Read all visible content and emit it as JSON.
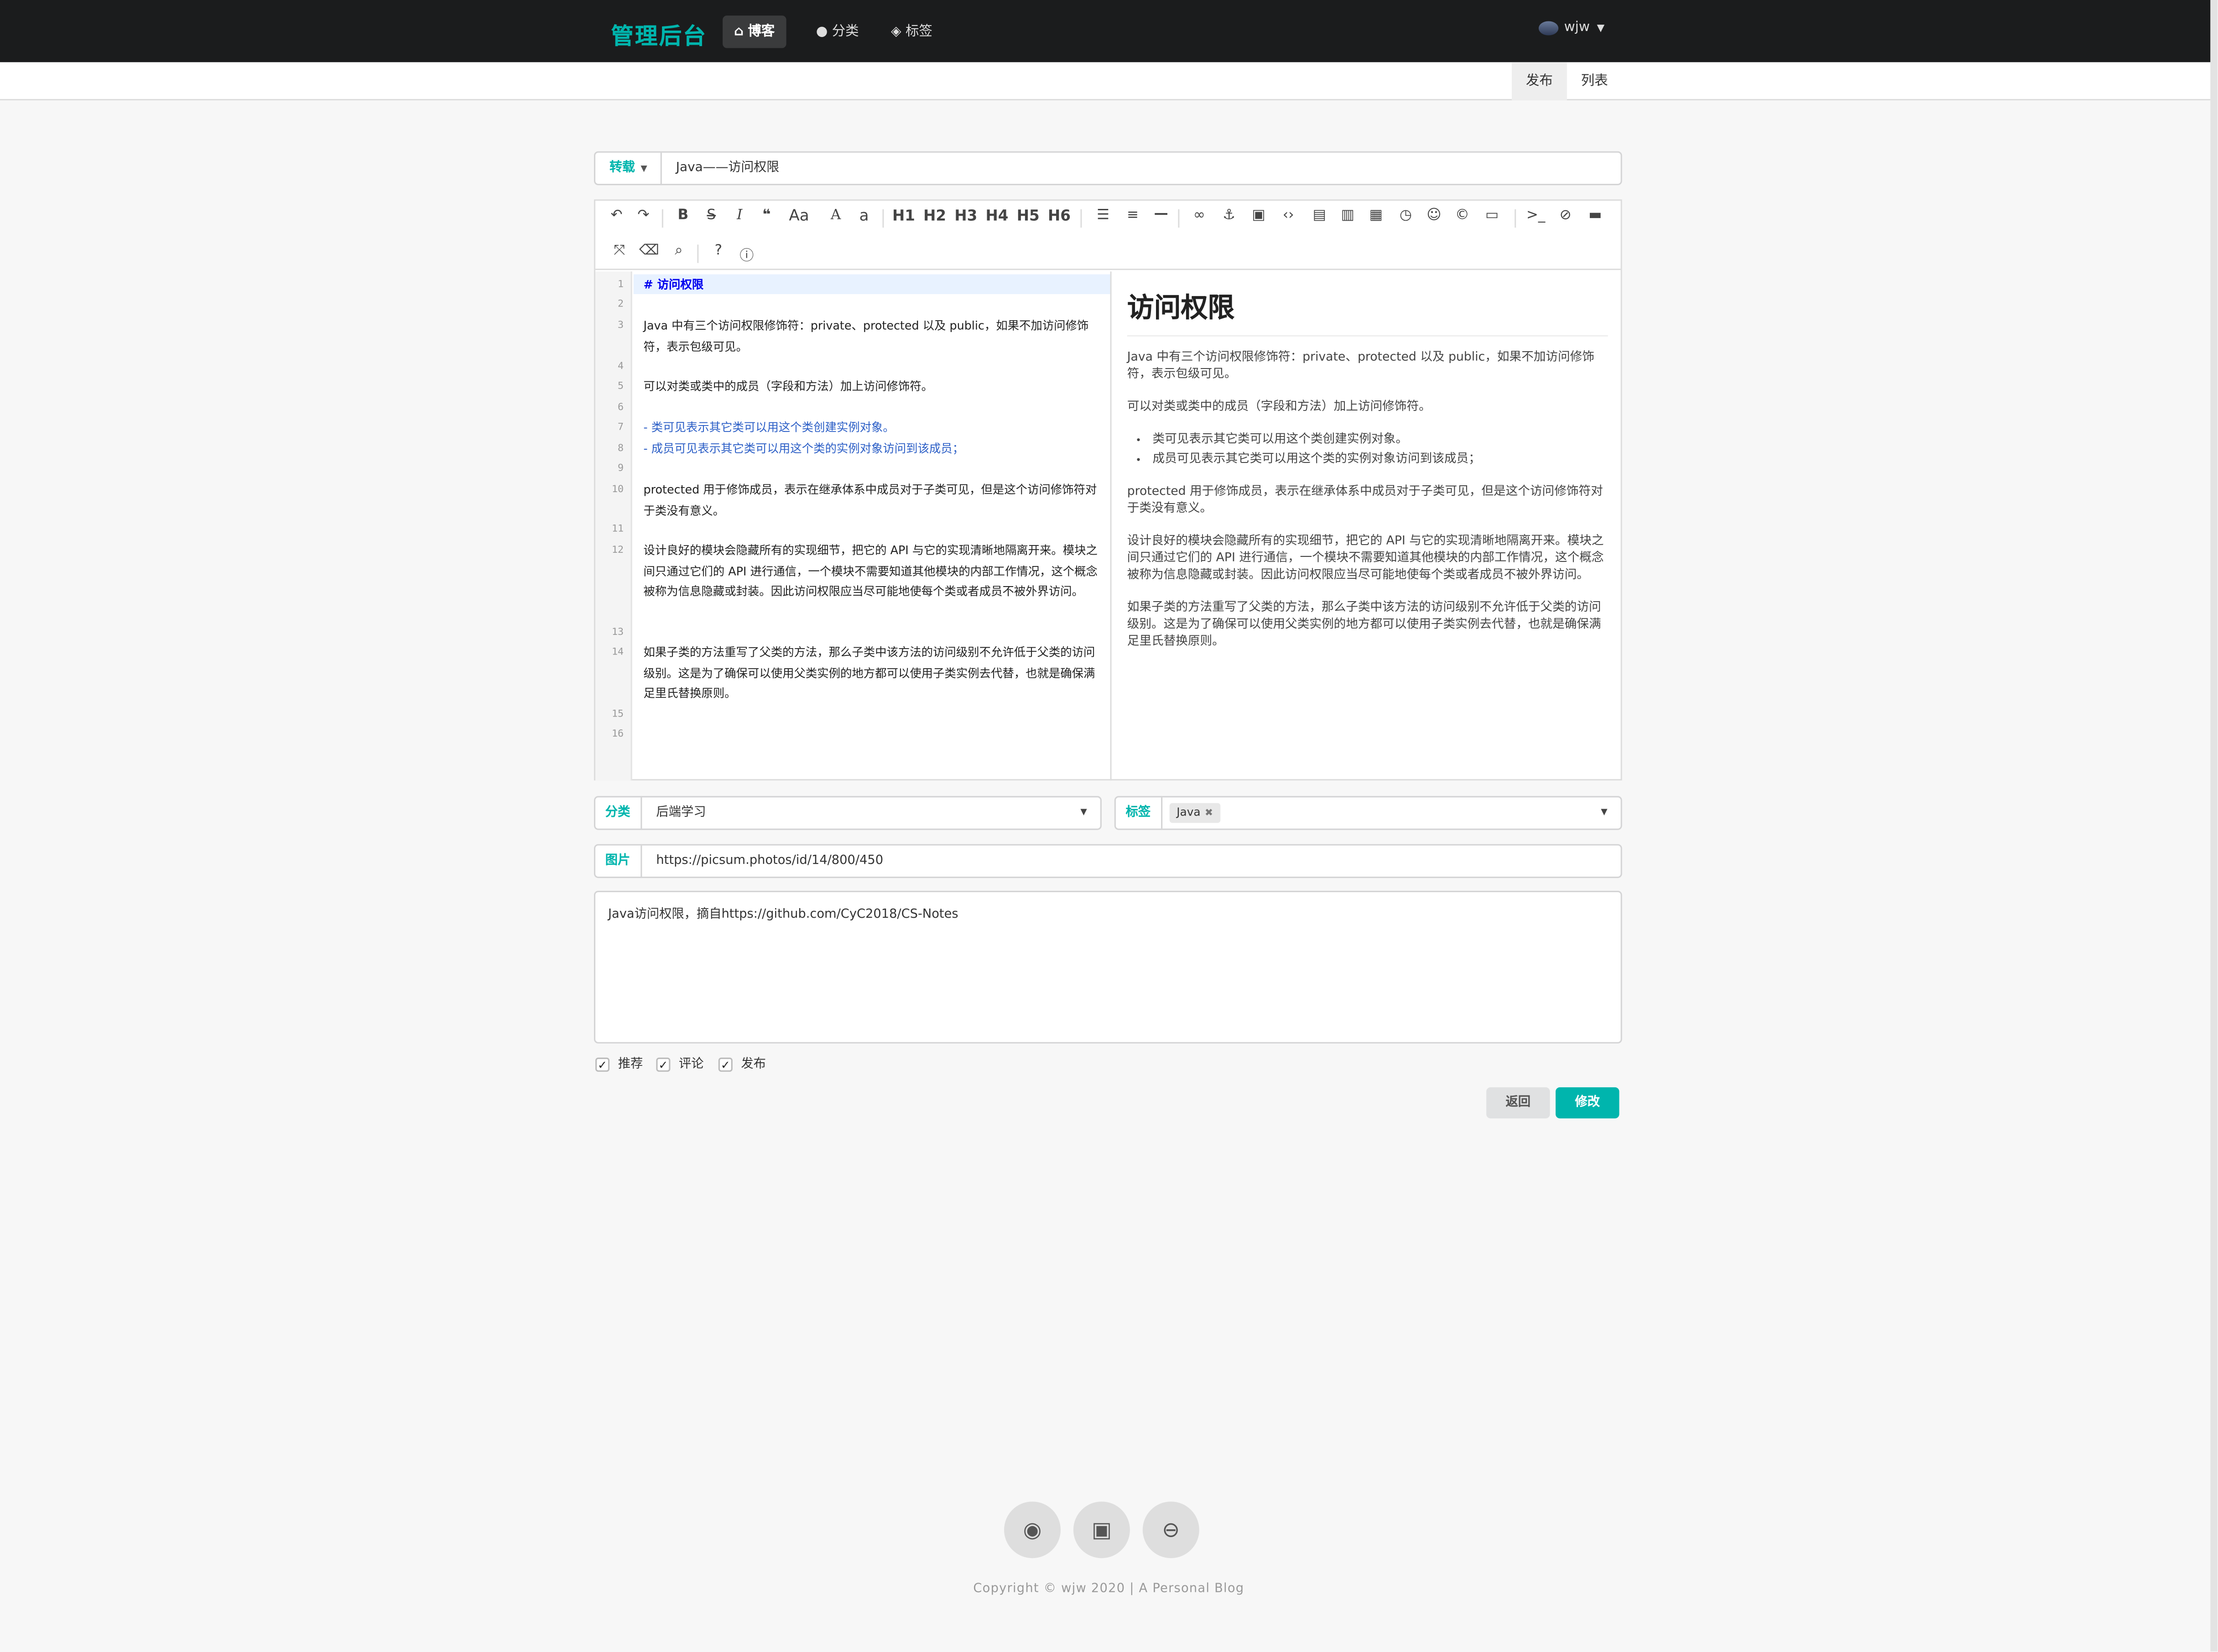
{
  "nav": {
    "brand": "管理后台",
    "items": [
      {
        "label": "博客",
        "icon": "home-icon",
        "active": true
      },
      {
        "label": "分类",
        "icon": "lightbulb-icon",
        "active": false
      },
      {
        "label": "标签",
        "icon": "tags-icon",
        "active": false
      }
    ],
    "user": "wjw"
  },
  "subnav": {
    "publish": "发布",
    "list": "列表"
  },
  "post": {
    "type_label": "转载",
    "title": "Java——访问权限"
  },
  "toolbar": {
    "headings": [
      "H1",
      "H2",
      "H3",
      "H4",
      "H5",
      "H6"
    ]
  },
  "editor": {
    "lines": [
      {
        "n": "1",
        "text": "# 访问权限"
      },
      {
        "n": "2",
        "text": ""
      },
      {
        "n": "3",
        "text": "Java 中有三个访问权限修饰符：private、protected 以及 public，如果不加访问修饰符，表示包级可见。"
      },
      {
        "n": "4",
        "text": ""
      },
      {
        "n": "5",
        "text": "可以对类或类中的成员（字段和方法）加上访问修饰符。"
      },
      {
        "n": "6",
        "text": ""
      },
      {
        "n": "7",
        "text": "- 类可见表示其它类可以用这个类创建实例对象。"
      },
      {
        "n": "8",
        "text": "- 成员可见表示其它类可以用这个类的实例对象访问到该成员；"
      },
      {
        "n": "9",
        "text": ""
      },
      {
        "n": "10",
        "text": "protected 用于修饰成员，表示在继承体系中成员对于子类可见，但是这个访问修饰符对于类没有意义。"
      },
      {
        "n": "11",
        "text": ""
      },
      {
        "n": "12",
        "text": "设计良好的模块会隐藏所有的实现细节，把它的 API 与它的实现清晰地隔离开来。模块之间只通过它们的 API 进行通信，一个模块不需要知道其他模块的内部工作情况，这个概念被称为信息隐藏或封装。因此访问权限应当尽可能地使每个类或者成员不被外界访问。"
      },
      {
        "n": "13",
        "text": ""
      },
      {
        "n": "14",
        "text": "如果子类的方法重写了父类的方法，那么子类中该方法的访问级别不允许低于父类的访问级别。这是为了确保可以使用父类实例的地方都可以使用子类实例去代替，也就是确保满足里氏替换原则。"
      },
      {
        "n": "15",
        "text": ""
      },
      {
        "n": "16",
        "text": ""
      }
    ]
  },
  "preview": {
    "h1": "访问权限",
    "p1": "Java 中有三个访问权限修饰符：private、protected 以及 public，如果不加访问修饰符，表示包级可见。",
    "p2": "可以对类或类中的成员（字段和方法）加上访问修饰符。",
    "li1": "类可见表示其它类可以用这个类创建实例对象。",
    "li2": "成员可见表示其它类可以用这个类的实例对象访问到该成员；",
    "p3": "protected 用于修饰成员，表示在继承体系中成员对于子类可见，但是这个访问修饰符对于类没有意义。",
    "p4": "设计良好的模块会隐藏所有的实现细节，把它的 API 与它的实现清晰地隔离开来。模块之间只通过它们的 API 进行通信，一个模块不需要知道其他模块的内部工作情况，这个概念被称为信息隐藏或封装。因此访问权限应当尽可能地使每个类或者成员不被外界访问。",
    "p5": "如果子类的方法重写了父类的方法，那么子类中该方法的访问级别不允许低于父类的访问级别。这是为了确保可以使用父类实例的地方都可以使用子类实例去代替，也就是确保满足里氏替换原则。"
  },
  "form": {
    "category_label": "分类",
    "category_value": "后端学习",
    "tag_label": "标签",
    "tag_value": "Java",
    "image_label": "图片",
    "image_url": "https://picsum.photos/id/14/800/450",
    "description": "Java访问权限，摘自https://github.com/CyC2018/CS-Notes",
    "checkboxes": {
      "recommend": "推荐",
      "comment": "评论",
      "publish": "发布"
    },
    "back_button": "返回",
    "save_button": "修改"
  },
  "footer": {
    "copyright": "Copyright © wjw 2020 | A Personal Blog",
    "icons": [
      "github-icon",
      "wechat-icon",
      "blog-icon"
    ]
  },
  "colors": {
    "accent": "#00b5ad",
    "navbar": "#1b1c1d"
  }
}
